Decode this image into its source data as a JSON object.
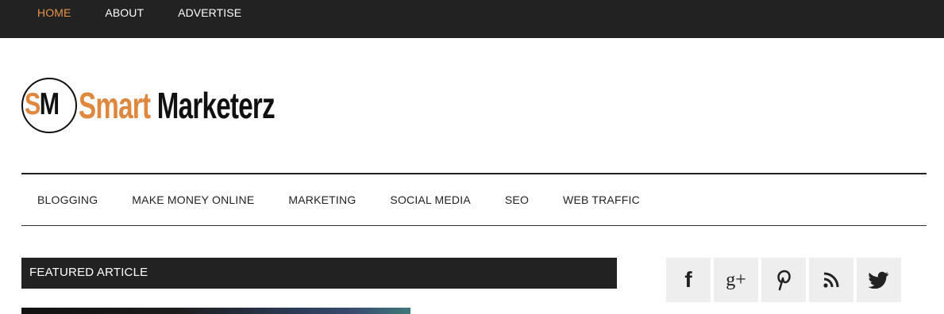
{
  "top_nav": {
    "items": [
      {
        "label": "HOME",
        "active": true
      },
      {
        "label": "ABOUT",
        "active": false
      },
      {
        "label": "ADVERTISE",
        "active": false
      }
    ],
    "active_color": "#e8944a"
  },
  "logo": {
    "monogram_s": "S",
    "monogram_m": "M",
    "word_1": "Smart",
    "word_2": "Marketerz",
    "accent_color": "#e0873f"
  },
  "main_nav": {
    "items": [
      "BLOGGING",
      "MAKE MONEY ONLINE",
      "MARKETING",
      "SOCIAL MEDIA",
      "SEO",
      "WEB TRAFFIC"
    ]
  },
  "featured": {
    "heading": "FEATURED ARTICLE"
  },
  "social": {
    "icons": [
      "facebook-icon",
      "google-plus-icon",
      "pinterest-icon",
      "rss-icon",
      "twitter-icon"
    ],
    "facebook_glyph": "f",
    "google_plus_glyph": "g+"
  }
}
